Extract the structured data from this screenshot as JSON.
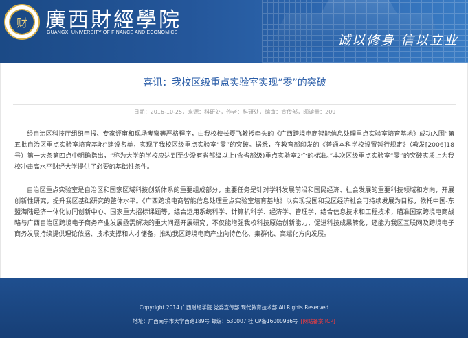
{
  "header": {
    "school_name_cn": "廣西財經學院",
    "school_name_en": "GUANGXI UNIVERSITY OF FINANCE AND ECONOMICS",
    "motto": "诚以修身  信以立业",
    "logo_glyph": "财"
  },
  "article": {
    "title": "喜讯：我校区级重点实验室实现“零”的突破",
    "meta": "日期：2016-10-25，来源：科研处，作者：科研处，编审：宣传部，阅读量：209",
    "paragraphs": [
      "经自治区科技厅组织申报、专家评审和现场考察等严格程序，由我校校长夏飞教授牵头的《广西跨境电商智能信息处理重点实验室培育基地》成功入围“第五批自治区重点实验室培育基地”建设名单，实现了我校区级重点实验室“零”的突破。据悉，在教育部印发的《普通本科学校设置暂行规定》（教发[2006]18号）第一大条第四点中明确指出，“称为大学的学校应达到至少没有省部级以上(含省部级)重点实验室2个的标准。”本次区级重点实验室“零”的突破实质上为我校冲击高水平财经大学提供了必要的基础性条件。",
      "自治区重点实验室是自治区和国家区域科技创新体系的重要组成部分，主要任务是针对学科发展前沿和国民经济、社会发展的重要科技领域和方向，开展创新性研究，提升我区基础研究的整体水平。《广西跨境电商智能信息处理重点实验室培育基地》以实现我国和我区经济社会可持续发展为目标，依托中国-东盟海陆经济一体化协同创新中心、国家重大招标课题等，综合运用系统科学、计算机科学、经济学、管理学，结合信息技术和工程技术，瞄准国家跨境电商战略与广西自治区跨境电子商务产业发展亟需解决的重大问题开展研究，不仅能增强我校科技原始创新能力，促进科技成果转化，还能为我区互联网及跨境电子商务发展持续提供理论依据、技术支撑和人才储备，推动我区跨境电商产业向特色化、集群化、高端化方向发展。"
    ]
  },
  "footer": {
    "copyright": "Copyright 2014 广西财经学院 党委宣传部 现代教育技术部 All Rights Reserved",
    "address": "地址：广西南宁市大学西路189号 邮编：530007 桂ICP备16000936号",
    "badge": "[网站备案 ICP]"
  },
  "colors": {
    "header_blue": "#24569a",
    "title_blue": "#2a5da8",
    "footer_blue": "#1f4f8f",
    "badge_red": "#ff3b3b"
  }
}
